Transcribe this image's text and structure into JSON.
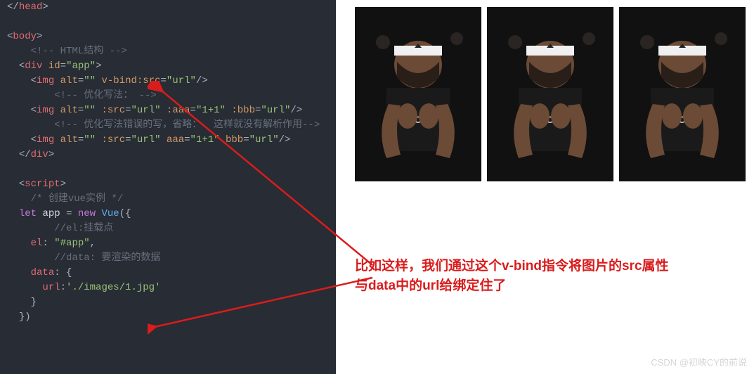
{
  "code": {
    "l1_close_head": "</head>",
    "l2": "",
    "l3_open_body": "<body>",
    "l4_c1": "  <!-- HTML结构 -->",
    "l5_div_open": "  <div id=\"app\">",
    "l6_img1": "    <img alt=\"\" v-bind:src=\"url\"/>",
    "l7_c2": "    <!-- 优化写法： -->",
    "l8_img2": "    <img alt=\"\" :src=\"url\" :aaa=\"1+1\" :bbb=\"url\"/>",
    "l9_c3": "    <!-- 优化写法错误的写，省略：  这样就没有解析作用-->",
    "l10_img3": "    <img alt=\"\" :src=\"url\" aaa=\"1+1\" bbb=\"url\"/>",
    "l11_div_close": "  </div>",
    "l12": "",
    "l13_script_open": "  <script>",
    "l14_c4": "  /* 创建vue实例 */",
    "l15_let": "  let app = new Vue({",
    "l16_c5": "    //el:挂载点",
    "l17_el": "    el: \"#app\",",
    "l18_c6": "    //data: 要渲染的数据",
    "l19_data": "    data: {",
    "l20_url": "      url:'./images/1.jpg'",
    "l21_close": "    }",
    "l22_close2": "  })"
  },
  "annotation_line1": "比如这样，我们通过这个v-bind指令将图片的src属性",
  "annotation_line2": "与data中的url给绑定住了",
  "watermark": "CSDN @初映CY的前说",
  "image_count": 3
}
